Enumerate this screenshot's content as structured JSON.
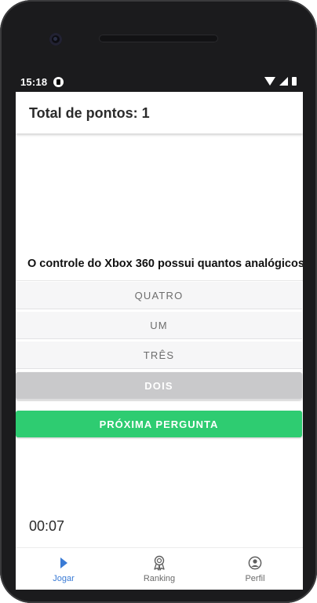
{
  "status_bar": {
    "time": "15:18"
  },
  "header": {
    "score_text": "Total de pontos: 1"
  },
  "quiz": {
    "question": "O controle do Xbox 360 possui quantos analógicos?",
    "options": [
      {
        "label": "QUATRO",
        "selected": false
      },
      {
        "label": "UM",
        "selected": false
      },
      {
        "label": "TRÊS",
        "selected": false
      },
      {
        "label": "DOIS",
        "selected": true
      }
    ],
    "next_button": "PRÓXIMA PERGUNTA",
    "timer": "00:07"
  },
  "bottom_nav": {
    "items": [
      {
        "label": "Jogar",
        "icon": "play-icon",
        "active": true
      },
      {
        "label": "Ranking",
        "icon": "award-icon",
        "active": false
      },
      {
        "label": "Perfil",
        "icon": "profile-icon",
        "active": false
      }
    ]
  },
  "colors": {
    "accent_green": "#2ecc71",
    "active_tab": "#3a7bd5",
    "selected_option": "#c9c9cb"
  }
}
